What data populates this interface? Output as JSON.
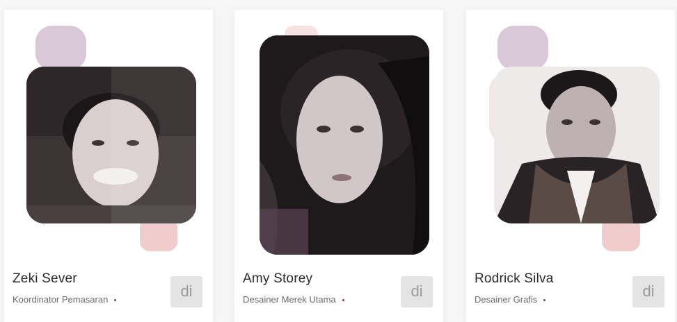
{
  "colors": {
    "lavender": "#d8c8d8",
    "blush": "#f1cccc",
    "pale_pink": "#f5e2e2",
    "accent_dot": "#7a3a6e",
    "button_bg": "#e4e4e4",
    "button_text": "#9a9a9a"
  },
  "team": [
    {
      "name": "Zeki Sever",
      "role": "Koordinator Pemasaran",
      "button_label": "di",
      "photo_icon": "portrait-man-smiling"
    },
    {
      "name": "Amy Storey",
      "role": "Desainer Merek Utama",
      "button_label": "di",
      "photo_icon": "portrait-woman"
    },
    {
      "name": "Rodrick Silva",
      "role": "Desainer Grafis",
      "button_label": "di",
      "photo_icon": "portrait-man-scarf"
    }
  ]
}
